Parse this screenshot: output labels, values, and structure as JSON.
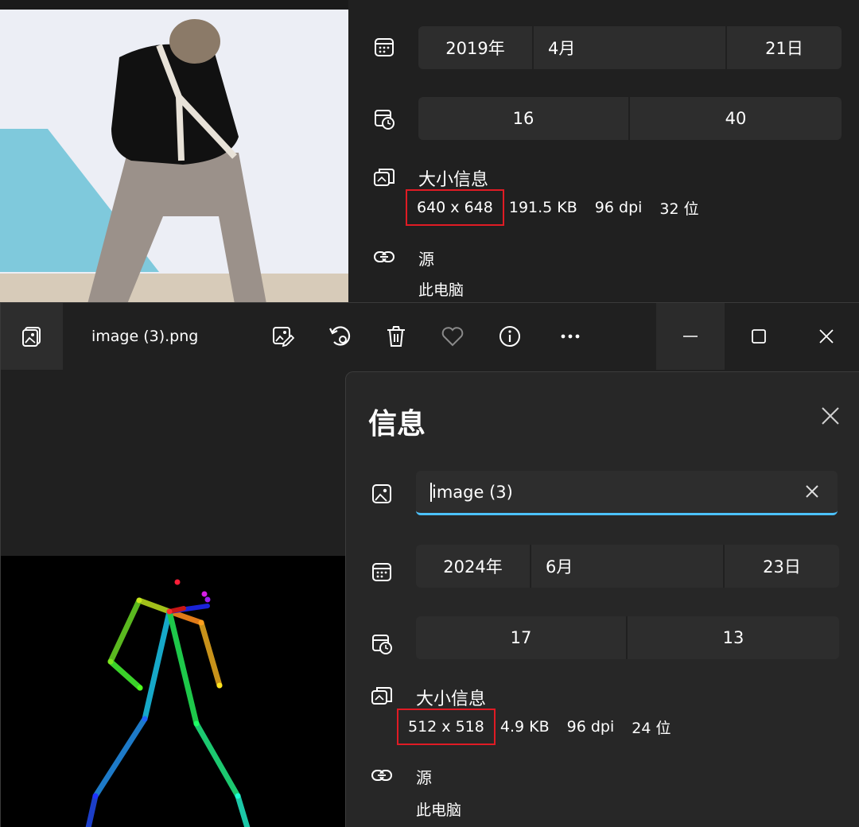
{
  "back_window": {
    "date": {
      "year": "2019年",
      "month": "4月",
      "day": "21日"
    },
    "time": {
      "hour": "16",
      "minute": "40"
    },
    "size_section_title": "大小信息",
    "dimensions": "640 x 648",
    "file_size": "191.5 KB",
    "dpi": "96 dpi",
    "bit_depth": "32 位",
    "source_title": "源",
    "source_value": "此电脑"
  },
  "front_window": {
    "toolbar": {
      "file_name": "image (3).png",
      "icons": [
        "photo-app-icon",
        "edit-image-icon",
        "rotate-icon",
        "delete-icon",
        "favorite-heart-icon",
        "info-icon",
        "more-icon",
        "minimize-icon",
        "maximize-icon",
        "close-icon"
      ]
    },
    "info_panel": {
      "title": "信息",
      "name_value": "image (3)",
      "date": {
        "year": "2024年",
        "month": "6月",
        "day": "23日"
      },
      "time": {
        "hour": "17",
        "minute": "13"
      },
      "size_section_title": "大小信息",
      "dimensions": "512 x 518",
      "file_size": "4.9 KB",
      "dpi": "96 dpi",
      "bit_depth": "24 位",
      "source_title": "源",
      "source_value": "此电脑"
    }
  },
  "colors": {
    "background": "#202020",
    "panel": "#272727",
    "field": "#2d2d2d",
    "accent": "#4cc2ff",
    "highlight_box": "#e01b24"
  }
}
